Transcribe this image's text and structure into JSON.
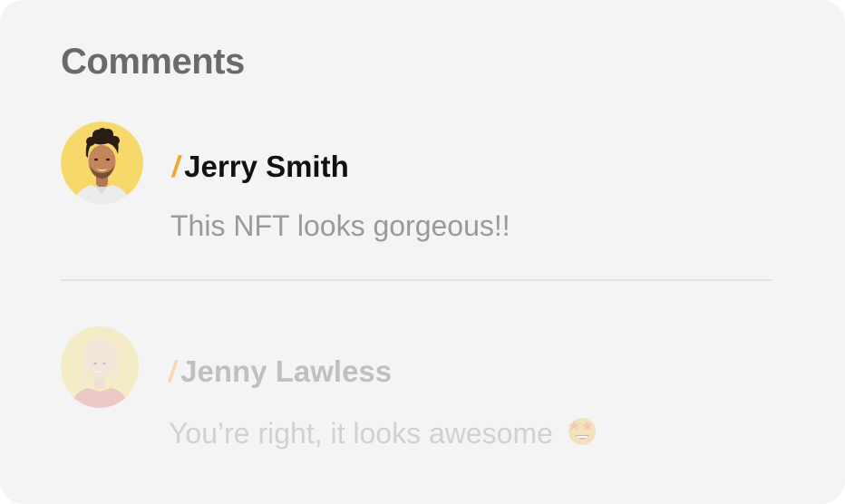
{
  "header": {
    "title": "Comments"
  },
  "comments": [
    {
      "name": "Jerry Smith",
      "message": "This NFT looks gorgeous!!",
      "avatar_icon": "user-avatar-man",
      "avatar_bg": "#f7d96b"
    },
    {
      "name": "Jenny Lawless",
      "message": "You’re right, it looks awesome",
      "avatar_icon": "user-avatar-woman",
      "avatar_bg": "#f7d96b",
      "trailing_icon": "starstruck-emoji-icon"
    }
  ],
  "colors": {
    "card_bg": "#f4f4f4",
    "accent": "#f4a623",
    "title": "#6a6a6a",
    "name": "#111111",
    "message": "#9a9a9a"
  }
}
